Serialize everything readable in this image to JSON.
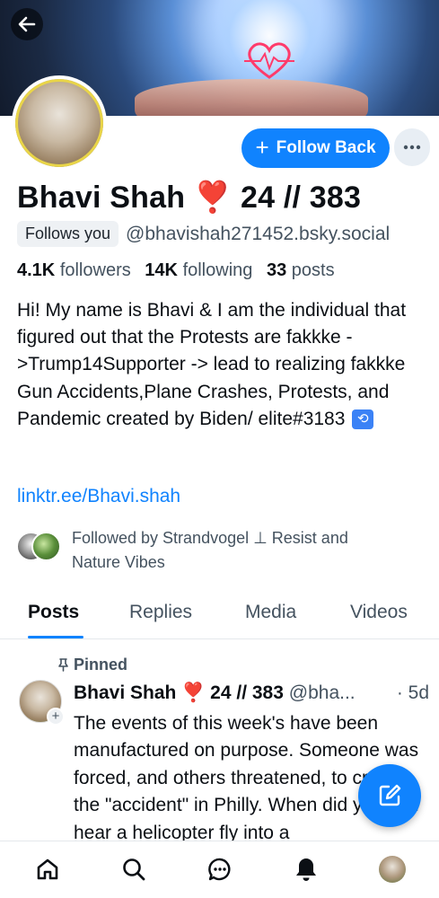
{
  "colors": {
    "accent": "#1083fe",
    "text_primary": "#0b0f14",
    "text_secondary": "#44525f"
  },
  "header": {
    "back_icon": "arrow-left-icon"
  },
  "profile": {
    "display_name": "Bhavi Shah ❣️ 24 // 383",
    "follows_you_badge": "Follows you",
    "handle": "@bhavishah271452.bsky.social",
    "stats": {
      "followers_count": "4.1K",
      "followers_label": "followers",
      "following_count": "14K",
      "following_label": "following",
      "posts_count": "33",
      "posts_label": "posts"
    },
    "bio": "Hi! My name is Bhavi & I am the individual that figured out that the Protests are fakkke ->Trump14Supporter -> lead to realizing fakkke Gun Accidents,Plane Crashes, Protests, and Pandemic created by Biden/ elite#3183",
    "bio_emoji": "🔁",
    "link": "linktr.ee/Bhavi.shah",
    "followed_by": "Followed by Strandvogel ⊥ Resist and Nature Vibes"
  },
  "actions": {
    "follow_back_label": "Follow Back",
    "follow_icon": "plus-icon",
    "more_icon": "ellipsis-icon"
  },
  "tabs": [
    {
      "label": "Posts",
      "active": true
    },
    {
      "label": "Replies",
      "active": false
    },
    {
      "label": "Media",
      "active": false
    },
    {
      "label": "Videos",
      "active": false
    }
  ],
  "pinned_post": {
    "pinned_label": "Pinned",
    "author_name": "Bhavi Shah ❣️ 24 // 383",
    "author_handle": "@bha...",
    "time": "· 5d",
    "text": "The events of this week's have been manufactured on purpose. Someone was forced, and others threatened, to create the \"accident\" in Philly. When did you last hear a helicopter fly into a"
  },
  "bottom_nav": [
    "home-icon",
    "search-icon",
    "chat-icon",
    "bell-icon",
    "profile-avatar"
  ]
}
